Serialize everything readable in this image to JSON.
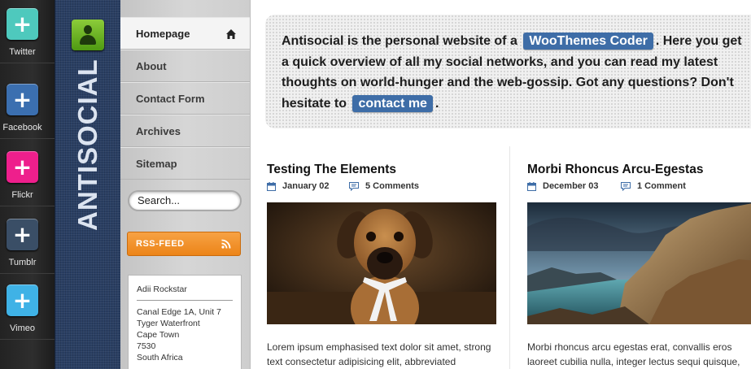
{
  "social": {
    "items": [
      {
        "label": "Twitter",
        "color": "#4ec9bd"
      },
      {
        "label": "Facebook",
        "color": "#3b6fb0"
      },
      {
        "label": "Flickr",
        "color": "#ee1f8c"
      },
      {
        "label": "Tumblr",
        "color": "#3a4e66"
      },
      {
        "label": "Vimeo",
        "color": "#3fb2e6"
      }
    ],
    "icon": "plus-icon"
  },
  "brand": {
    "logo_text": "ANTISOCIAL",
    "avatar_icon": "user-icon"
  },
  "nav": {
    "items": [
      {
        "label": "Homepage"
      },
      {
        "label": "About"
      },
      {
        "label": "Contact Form"
      },
      {
        "label": "Archives"
      },
      {
        "label": "Sitemap"
      }
    ],
    "search_placeholder": "Search...",
    "rss_label": "RSS-FEED"
  },
  "address": {
    "name": "Adii Rockstar",
    "lines": [
      "Canal Edge 1A, Unit 7",
      "Tyger Waterfront",
      "Cape Town",
      "7530",
      "South Africa"
    ]
  },
  "intro": {
    "part1": "Antisocial is the personal website of a",
    "link1": "WooThemes Coder",
    "part2": ". Here you get a quick overview of all my social networks, and you can read my latest thoughts on world-hunger and the web-gossip. Got any questions? Don't hesitate to",
    "link2": "contact me",
    "part3": "."
  },
  "posts": [
    {
      "title": "Testing The Elements",
      "date": "January 02",
      "comments": "5 Comments",
      "excerpt": "Lorem ipsum emphasised text dolor sit amet, strong text consectetur adipisicing elit, abbreviated"
    },
    {
      "title": "Morbi Rhoncus Arcu-Egestas",
      "date": "December 03",
      "comments": "1 Comment",
      "excerpt": "Morbi rhoncus arcu egestas erat, convallis eros laoreet cubilia nulla, integer lectus sequi quisque,"
    }
  ]
}
